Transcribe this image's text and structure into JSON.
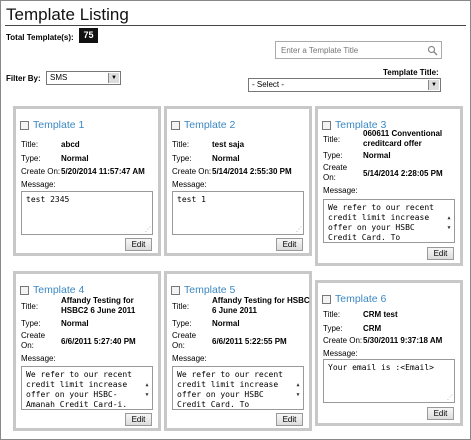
{
  "header": {
    "title": "Template Listing",
    "total_label": "Total Template(s):",
    "total_count": "75"
  },
  "search": {
    "placeholder": "Enter a Template Title"
  },
  "filter": {
    "label": "Filter By:",
    "selected": "SMS"
  },
  "template_title": {
    "label": "Template Title:",
    "selected": "- Select -"
  },
  "field_labels": {
    "title": "Title:",
    "type": "Type:",
    "create_on": "Create On:",
    "message": "Message:",
    "edit": "Edit"
  },
  "templates": [
    {
      "name": "Template 1",
      "title": "abcd",
      "type": "Normal",
      "created": "5/20/2014 11:57:47 AM",
      "message": "test 2345"
    },
    {
      "name": "Template 2",
      "title": "test saja",
      "type": "Normal",
      "created": "5/14/2014 2:55:30 PM",
      "message": "test 1"
    },
    {
      "name": "Template 3",
      "title": "060611 Conventional creditcard offer",
      "type": "Normal",
      "created": "5/14/2014 2:28:05 PM",
      "message": "We refer to our recent credit limit increase offer on your HSBC Credit Card. To"
    },
    {
      "name": "Template 4",
      "title": "Affandy Testing for HSBC2 6 June 2011",
      "type": "Normal",
      "created": "6/6/2011 5:27:40 PM",
      "message": "We refer to our recent credit limit increase offer on your HSBC-Amanah Credit Card-i."
    },
    {
      "name": "Template 5",
      "title": "Affandy Testing for HSBC 6 June 2011",
      "type": "Normal",
      "created": "6/6/2011 5:22:55 PM",
      "message": "We refer to our recent credit limit increase offer on your HSBC Credit Card. To"
    },
    {
      "name": "Template 6",
      "title": "CRM test",
      "type": "CRM",
      "created": "5/30/2011 9:37:18 AM",
      "message": "Your email is :<Email>"
    }
  ],
  "colors": {
    "link_blue": "#3b88c4",
    "card_border": "#c8c8c8",
    "count_badge": "#111111"
  },
  "icons": {
    "search": "magnifier-icon",
    "dropdown": "chevron-down-icon"
  }
}
